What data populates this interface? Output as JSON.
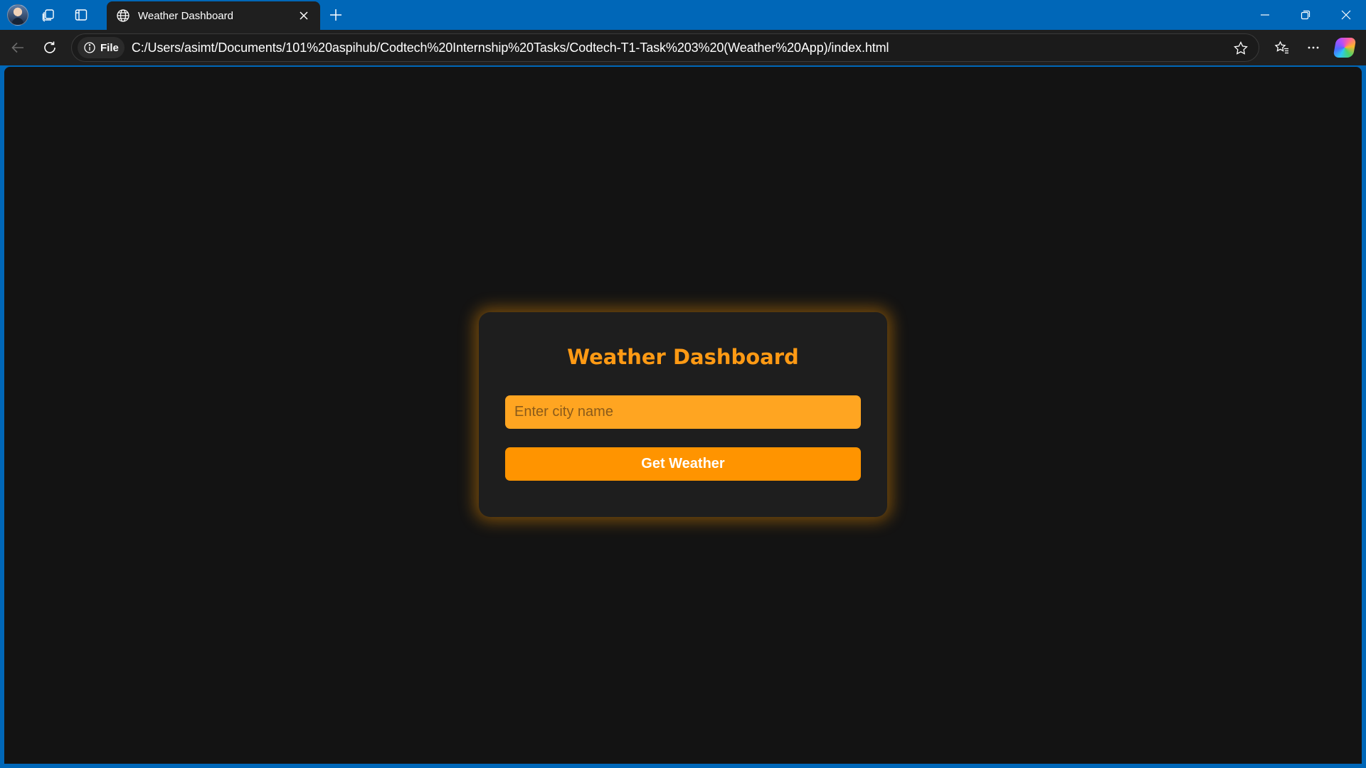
{
  "browser": {
    "tab": {
      "title": "Weather Dashboard",
      "icon": "globe-icon"
    },
    "toolbar": {
      "scheme_chip_label": "File",
      "url": "C:/Users/asimt/Documents/101%20aspihub/Codtech%20Internship%20Tasks/Codtech-T1-Task%203%20(Weather%20App)/index.html"
    },
    "icons": [
      "profile-avatar",
      "workspaces-icon",
      "vertical-tabs-icon",
      "globe-icon",
      "close-icon",
      "plus-icon",
      "minimize-icon",
      "restore-icon",
      "close-window-icon",
      "back-arrow-icon",
      "refresh-icon",
      "info-icon",
      "star-icon",
      "favorites-icon",
      "more-icon",
      "copilot-icon"
    ],
    "colors": {
      "titlebar": "#0067b8",
      "tab_active": "#1f1f1f",
      "toolbar": "#1f1f1f"
    }
  },
  "page": {
    "title": "Weather Dashboard",
    "city_input": {
      "placeholder": "Enter city name",
      "value": ""
    },
    "button_label": "Get Weather",
    "colors": {
      "background": "#131313",
      "card": "#1e1e1e",
      "accent": "#ff9a14",
      "input": "#ffa521",
      "button": "#ff9400",
      "button_text": "#ffffff"
    }
  }
}
